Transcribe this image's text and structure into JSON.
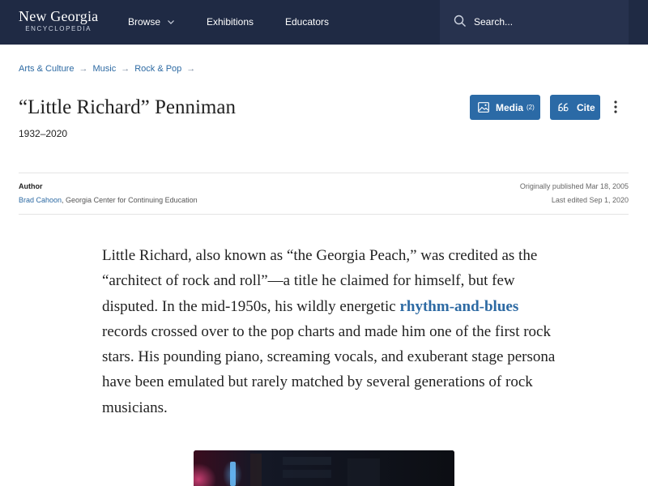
{
  "header": {
    "logo_title": "New Georgia",
    "logo_subtitle": "ENCYCLOPEDIA",
    "nav": {
      "browse": "Browse",
      "exhibitions": "Exhibitions",
      "educators": "Educators"
    },
    "search_placeholder": "Search...",
    "background_color": "#1f2a44"
  },
  "breadcrumb": [
    "Arts & Culture",
    "Music",
    "Rock & Pop"
  ],
  "article": {
    "title": "“Little Richard” Penniman",
    "dates": "1932–2020",
    "buttons": {
      "media_label": "Media",
      "media_count": "(2)",
      "cite_label": "Cite"
    },
    "meta": {
      "author_heading": "Author",
      "author_name": "Brad Cahoon",
      "author_affiliation": ", Georgia Center for Continuing Education",
      "published": "Originally published Mar 18, 2005",
      "edited": "Last edited Sep 1, 2020"
    },
    "body": {
      "before_link": "Little Richard, also known as “the Georgia Peach,” was credited as the “architect of rock and roll”—a title he claimed for himself, but few disputed. In the mid-1950s, his wildly energetic ",
      "link_text": "rhythm-and-blues",
      "after_link": " records crossed over to the pop charts and made him one of the first rock stars. His pounding piano, screaming vocals, and exuberant stage persona have been emulated but rarely matched by several generations of rock musicians."
    }
  },
  "colors": {
    "accent": "#2b6aa6",
    "link": "#2d6aa3"
  },
  "icons": {
    "search": "search-icon",
    "chevron": "chevron-down-icon",
    "media": "image-icon",
    "cite": "quote-icon",
    "more": "more-vertical-icon",
    "arrow": "arrow-right-icon"
  }
}
